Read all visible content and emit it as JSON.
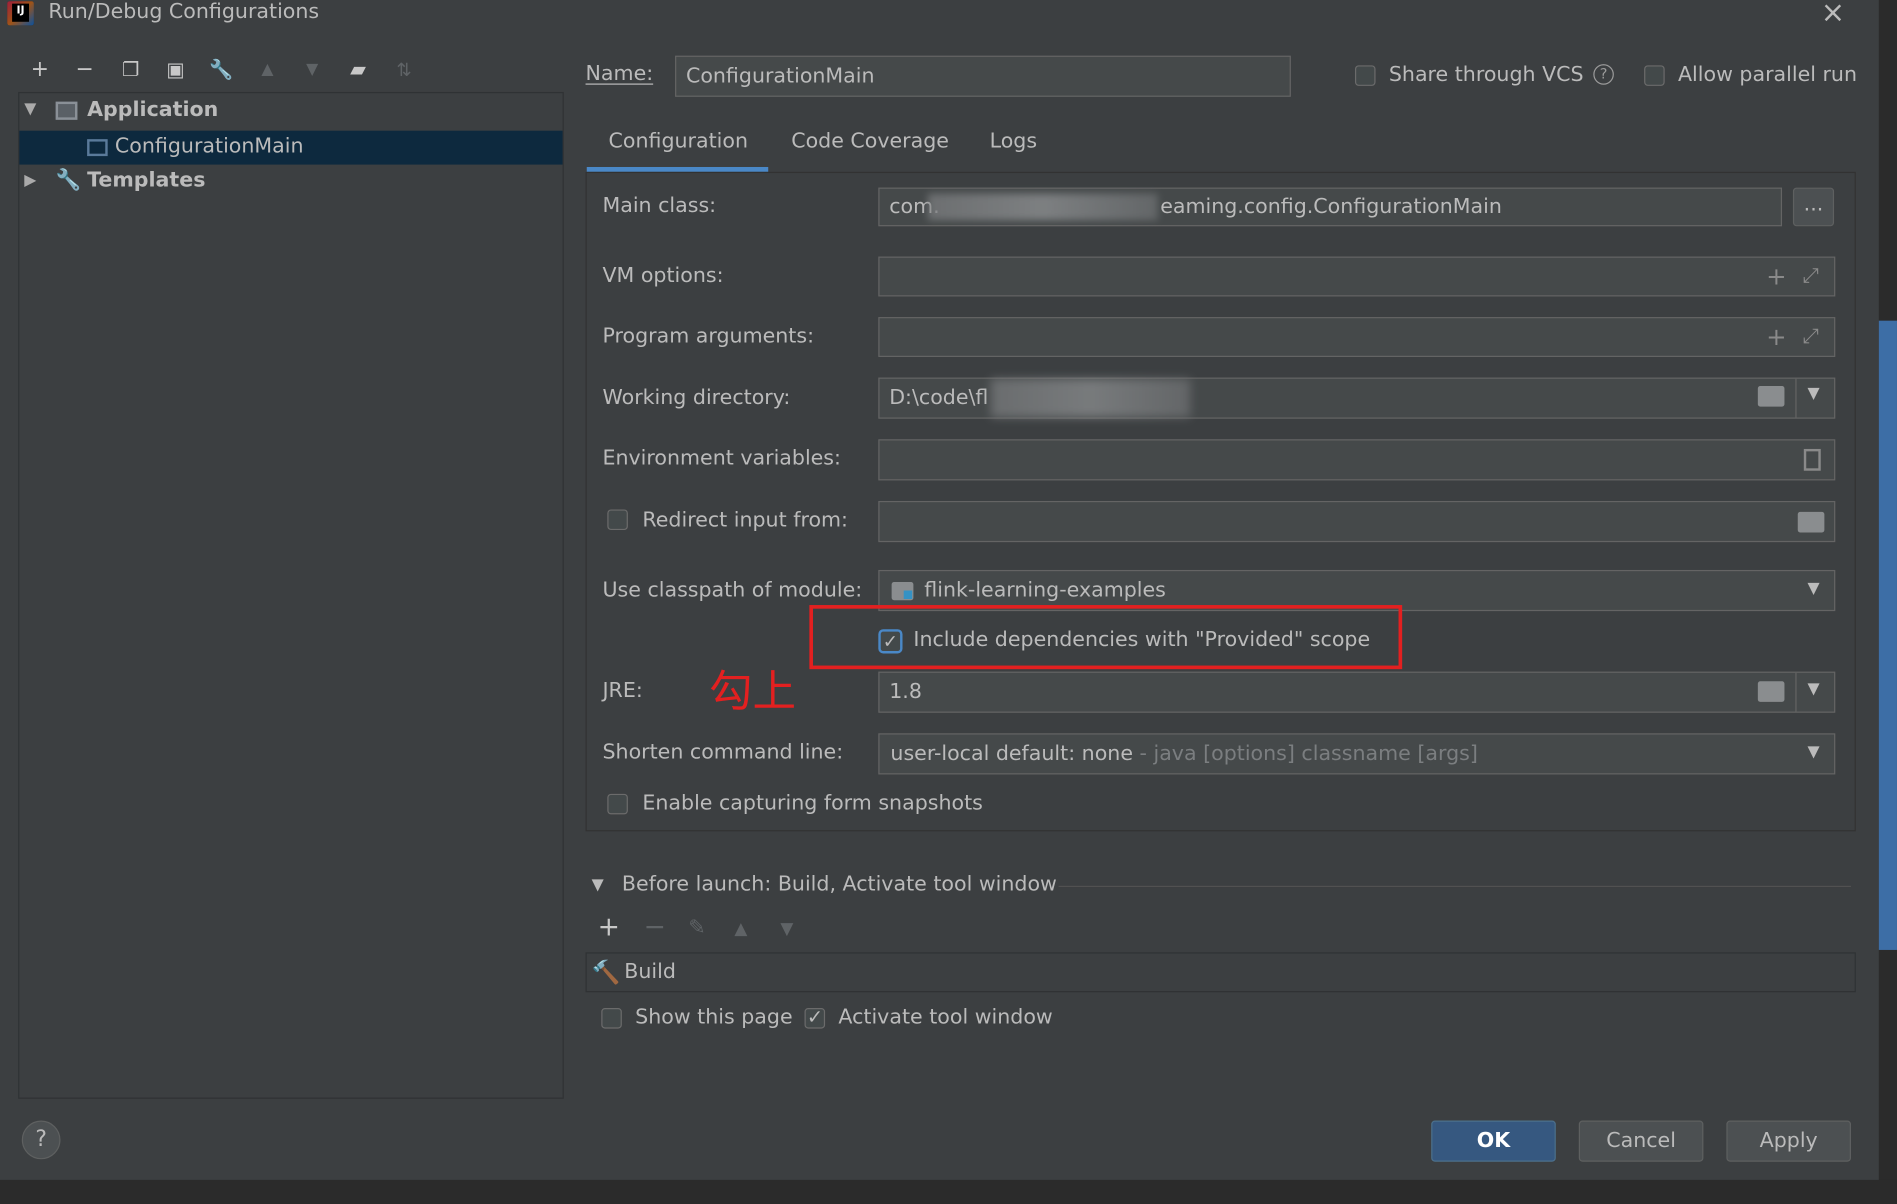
{
  "window": {
    "title": "Run/Debug Configurations"
  },
  "tree": {
    "application": "Application",
    "configuration": "ConfigurationMain",
    "templates": "Templates"
  },
  "header": {
    "name_label": "Name:",
    "name_value": "ConfigurationMain",
    "share_vcs": "Share through VCS",
    "allow_parallel": "Allow parallel run"
  },
  "tabs": [
    "Configuration",
    "Code Coverage",
    "Logs"
  ],
  "config": {
    "main_class_label": "Main class:",
    "main_class_prefix": "com.",
    "main_class_suffix": "eaming.config.ConfigurationMain",
    "vm_options_label": "VM options:",
    "program_args_label": "Program arguments:",
    "working_dir_label": "Working directory:",
    "working_dir_value": "D:\\code\\fl",
    "env_vars_label": "Environment variables:",
    "redirect_label": "Redirect input from:",
    "classpath_label": "Use classpath of module:",
    "classpath_value": "flink-learning-examples",
    "include_deps": "Include dependencies with \"Provided\" scope",
    "jre_label": "JRE:",
    "jre_value": "1.8",
    "shorten_label": "Shorten command line:",
    "shorten_value": "user-local default: none",
    "shorten_hint": " - java [options] classname [args]",
    "snapshots_label": "Enable capturing form snapshots",
    "browse_label": "...",
    "annotation": "勾上"
  },
  "before_launch": {
    "title": "Before launch: Build, Activate tool window",
    "build": "Build",
    "show_page": "Show this page",
    "activate_tool": "Activate tool window"
  },
  "buttons": {
    "ok": "OK",
    "cancel": "Cancel",
    "apply": "Apply",
    "help": "?"
  },
  "colors": {
    "accent": "#4a88c7",
    "selection": "#0d293e",
    "annotation": "#e32020",
    "ok_button": "#365880"
  }
}
